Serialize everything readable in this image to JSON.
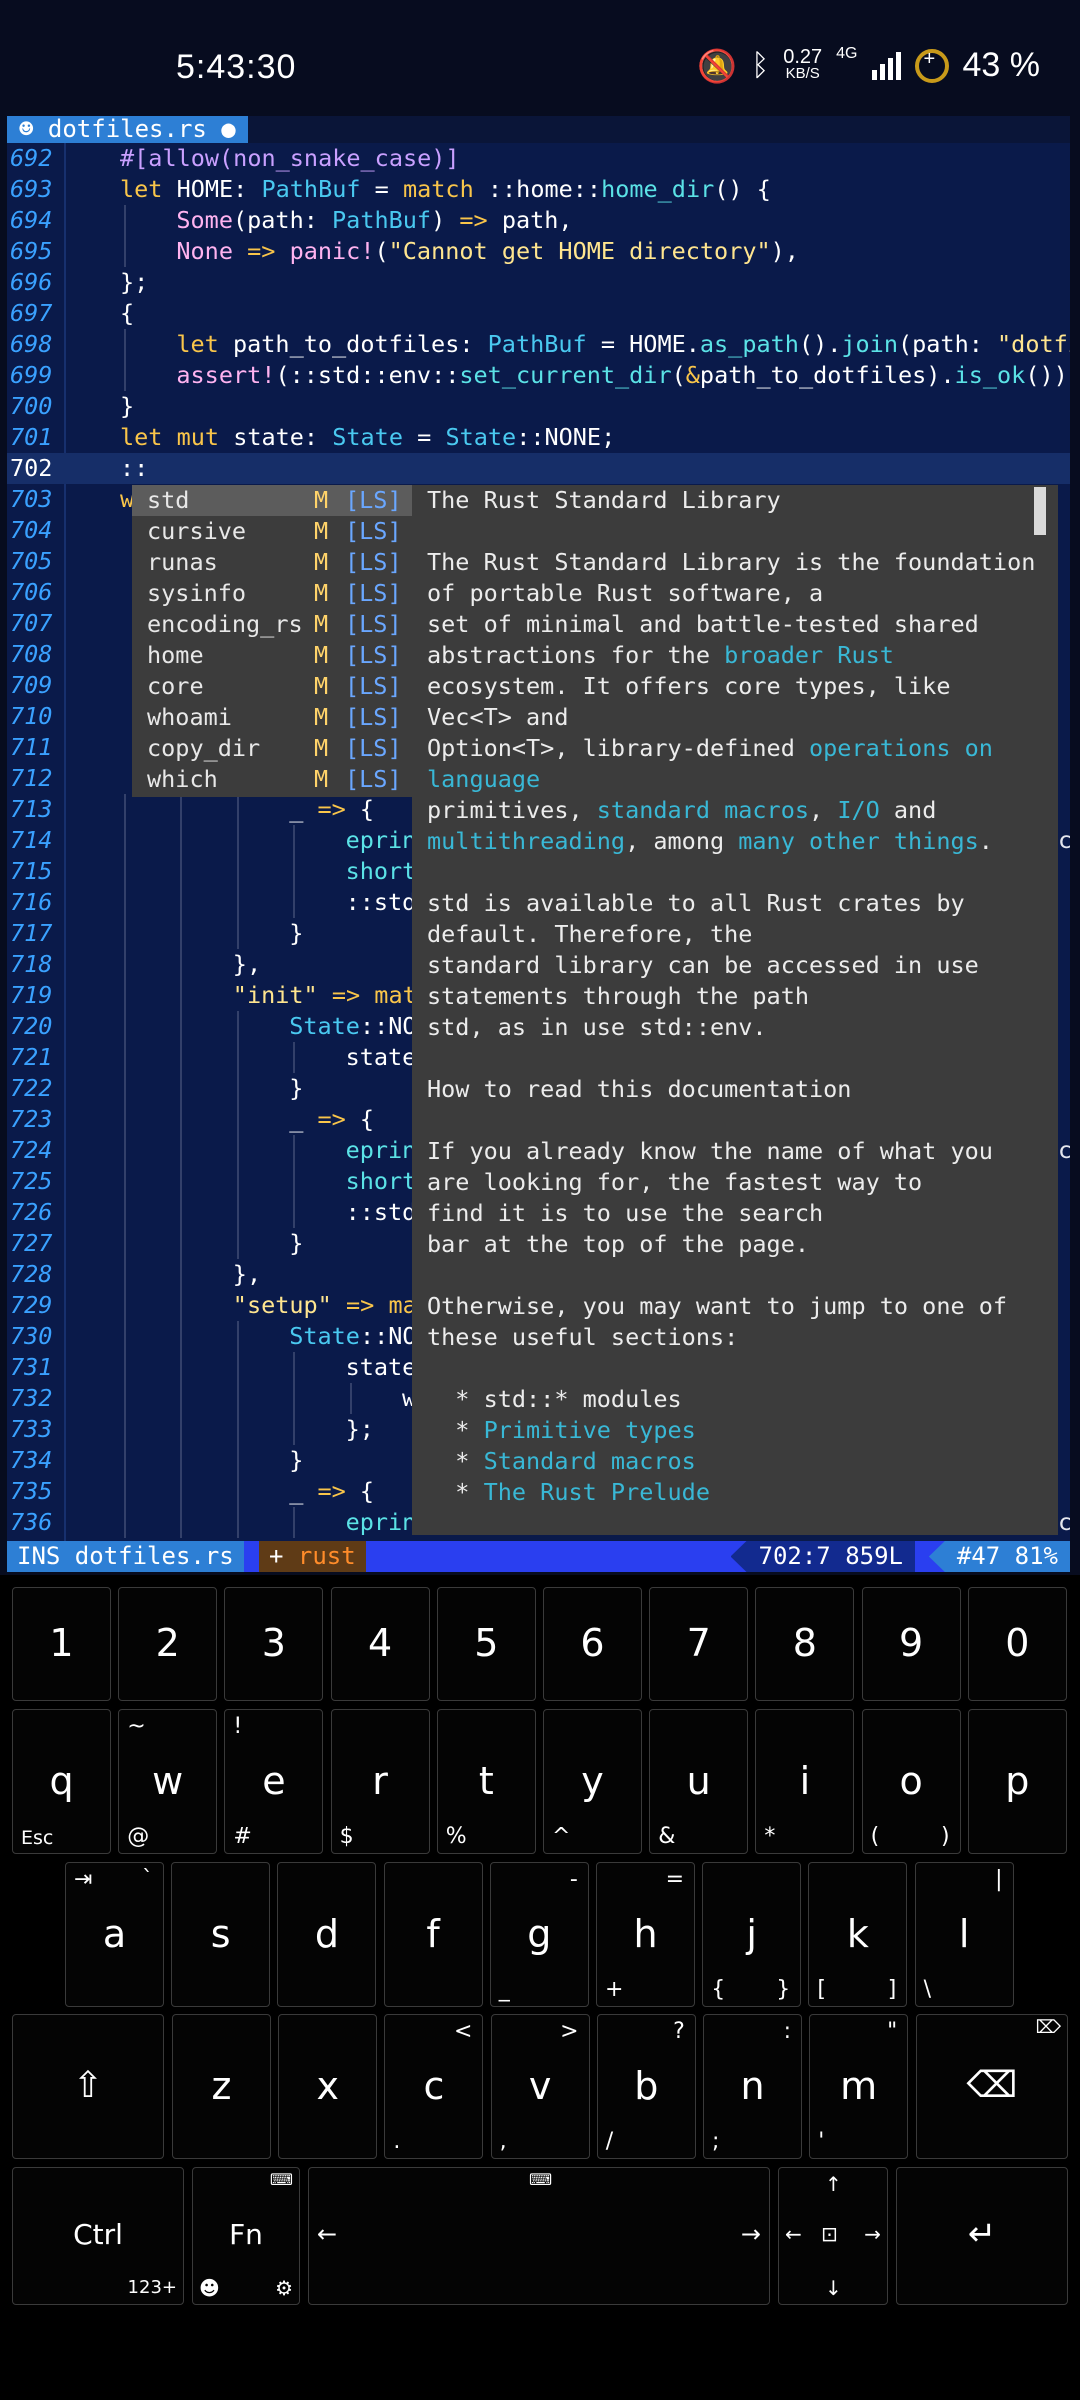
{
  "status": {
    "time": "5:43:30",
    "net_speed_value": "0.27",
    "net_speed_unit": "KB/S",
    "net_type": "4G",
    "battery": "43 %"
  },
  "tab": {
    "label": "☻ dotfiles.rs ●"
  },
  "lines": [
    {
      "num": "692",
      "indent": 0,
      "segs": [
        [
          "pp",
          "#[allow(non_snake_case)]"
        ]
      ]
    },
    {
      "num": "693",
      "indent": 0,
      "segs": [
        [
          "kw",
          "let "
        ],
        [
          "lt",
          "HOME: "
        ],
        [
          "ty",
          "PathBuf"
        ],
        [
          "lt",
          " = "
        ],
        [
          "kw",
          "match "
        ],
        [
          "lt",
          "::home::"
        ],
        [
          "fn",
          "home_dir"
        ],
        [
          "lt",
          "() {"
        ]
      ]
    },
    {
      "num": "694",
      "indent": 1,
      "segs": [
        [
          "mac",
          "Some"
        ],
        [
          "lt",
          "(path: "
        ],
        [
          "ty",
          "PathBuf"
        ],
        [
          "lt",
          ") "
        ],
        [
          "op",
          "=>"
        ],
        [
          "lt",
          " path,"
        ]
      ]
    },
    {
      "num": "695",
      "indent": 1,
      "segs": [
        [
          "mac",
          "None"
        ],
        [
          "lt",
          " "
        ],
        [
          "op",
          "=>"
        ],
        [
          "lt",
          " "
        ],
        [
          "mac",
          "panic!"
        ],
        [
          "lt",
          "("
        ],
        [
          "st",
          "\"Cannot get HOME directory\""
        ],
        [
          "lt",
          "),"
        ]
      ]
    },
    {
      "num": "696",
      "indent": 0,
      "segs": [
        [
          "lt",
          "};"
        ]
      ]
    },
    {
      "num": "697",
      "indent": 0,
      "segs": [
        [
          "lt",
          "{"
        ]
      ]
    },
    {
      "num": "698",
      "indent": 1,
      "segs": [
        [
          "kw",
          "let "
        ],
        [
          "lt",
          "path_to_dotfiles: "
        ],
        [
          "ty",
          "PathBuf"
        ],
        [
          "lt",
          " = HOME."
        ],
        [
          "fn",
          "as_path"
        ],
        [
          "lt",
          "()."
        ],
        [
          "fn",
          "join"
        ],
        [
          "lt",
          "(path: "
        ],
        [
          "st",
          "\"dotfi"
        ]
      ]
    },
    {
      "num": "699",
      "indent": 1,
      "segs": [
        [
          "mac",
          "assert!"
        ],
        [
          "lt",
          "(::std::env::"
        ],
        [
          "fn",
          "set_current_dir"
        ],
        [
          "lt",
          "("
        ],
        [
          "op",
          "&"
        ],
        [
          "lt",
          "path_to_dotfiles)."
        ],
        [
          "fn",
          "is_ok"
        ],
        [
          "lt",
          "());"
        ]
      ]
    },
    {
      "num": "700",
      "indent": 0,
      "segs": [
        [
          "lt",
          "}"
        ]
      ]
    },
    {
      "num": "701",
      "indent": 0,
      "segs": [
        [
          "kw",
          "let "
        ],
        [
          "kw",
          "mut "
        ],
        [
          "lt",
          "state: "
        ],
        [
          "ty",
          "State"
        ],
        [
          "lt",
          " = "
        ],
        [
          "ty",
          "State"
        ],
        [
          "lt",
          "::NONE;"
        ]
      ]
    },
    {
      "num": "702",
      "indent": 0,
      "cur": true,
      "segs": [
        [
          "lt",
          "::"
        ]
      ]
    },
    {
      "num": "703",
      "indent": 0,
      "segs": [
        [
          "kw",
          "w"
        ]
      ]
    },
    {
      "num": "704",
      "indent": 0,
      "segs": []
    },
    {
      "num": "705",
      "indent": 0,
      "segs": []
    },
    {
      "num": "706",
      "indent": 0,
      "segs": []
    },
    {
      "num": "707",
      "indent": 0,
      "segs": []
    },
    {
      "num": "708",
      "indent": 0,
      "segs": []
    },
    {
      "num": "709",
      "indent": 0,
      "segs": []
    },
    {
      "num": "710",
      "indent": 0,
      "segs": []
    },
    {
      "num": "711",
      "indent": 0,
      "segs": []
    },
    {
      "num": "712",
      "indent": 0,
      "segs": []
    },
    {
      "num": "713",
      "indent": 3,
      "segs": [
        [
          "lt",
          "_ "
        ],
        [
          "op",
          "=>"
        ],
        [
          "lt",
          " {"
        ]
      ]
    },
    {
      "num": "714",
      "indent": 4,
      "segs": [
        [
          "fn",
          "eprin"
        ]
      ]
    },
    {
      "num": "715",
      "indent": 4,
      "segs": [
        [
          "fn",
          "short"
        ]
      ]
    },
    {
      "num": "716",
      "indent": 4,
      "segs": [
        [
          "lt",
          "::std"
        ]
      ]
    },
    {
      "num": "717",
      "indent": 3,
      "segs": [
        [
          "lt",
          "}"
        ]
      ]
    },
    {
      "num": "718",
      "indent": 2,
      "segs": [
        [
          "lt",
          "},"
        ]
      ]
    },
    {
      "num": "719",
      "indent": 2,
      "segs": [
        [
          "st",
          "\"init\""
        ],
        [
          "lt",
          " "
        ],
        [
          "op",
          "=>"
        ],
        [
          "lt",
          " "
        ],
        [
          "kw",
          "mat"
        ]
      ]
    },
    {
      "num": "720",
      "indent": 3,
      "segs": [
        [
          "ty",
          "State"
        ],
        [
          "lt",
          "::NO"
        ]
      ]
    },
    {
      "num": "721",
      "indent": 4,
      "segs": [
        [
          "lt",
          "state"
        ]
      ]
    },
    {
      "num": "722",
      "indent": 3,
      "segs": [
        [
          "lt",
          "}"
        ]
      ]
    },
    {
      "num": "723",
      "indent": 3,
      "segs": [
        [
          "lt",
          "_ "
        ],
        [
          "op",
          "=>"
        ],
        [
          "lt",
          " {"
        ]
      ]
    },
    {
      "num": "724",
      "indent": 4,
      "segs": [
        [
          "fn",
          "eprin"
        ]
      ]
    },
    {
      "num": "725",
      "indent": 4,
      "segs": [
        [
          "fn",
          "short"
        ]
      ]
    },
    {
      "num": "726",
      "indent": 4,
      "segs": [
        [
          "lt",
          "::std"
        ]
      ]
    },
    {
      "num": "727",
      "indent": 3,
      "segs": [
        [
          "lt",
          "}"
        ]
      ]
    },
    {
      "num": "728",
      "indent": 2,
      "segs": [
        [
          "lt",
          "},"
        ]
      ]
    },
    {
      "num": "729",
      "indent": 2,
      "segs": [
        [
          "st",
          "\"setup\""
        ],
        [
          "lt",
          " "
        ],
        [
          "op",
          "=>"
        ],
        [
          "lt",
          " "
        ],
        [
          "kw",
          "ma"
        ]
      ]
    },
    {
      "num": "730",
      "indent": 3,
      "segs": [
        [
          "ty",
          "State"
        ],
        [
          "lt",
          "::NO"
        ]
      ]
    },
    {
      "num": "731",
      "indent": 4,
      "segs": [
        [
          "lt",
          "state"
        ]
      ]
    },
    {
      "num": "732",
      "indent": 5,
      "segs": [
        [
          "lt",
          "w"
        ]
      ]
    },
    {
      "num": "733",
      "indent": 4,
      "segs": [
        [
          "lt",
          "};"
        ]
      ]
    },
    {
      "num": "734",
      "indent": 3,
      "segs": [
        [
          "lt",
          "}"
        ]
      ]
    },
    {
      "num": "735",
      "indent": 3,
      "segs": [
        [
          "lt",
          "_ "
        ],
        [
          "op",
          "=>"
        ],
        [
          "lt",
          " {"
        ]
      ]
    },
    {
      "num": "736",
      "indent": 4,
      "segs": [
        [
          "fn",
          "eprin"
        ]
      ]
    }
  ],
  "right_edge": {
    "714": "c",
    "724": "c",
    "736": "c"
  },
  "completion": {
    "items": [
      {
        "name": "std",
        "kind": "M",
        "source": "[LS]"
      },
      {
        "name": "cursive",
        "kind": "M",
        "source": "[LS]"
      },
      {
        "name": "runas",
        "kind": "M",
        "source": "[LS]"
      },
      {
        "name": "sysinfo",
        "kind": "M",
        "source": "[LS]"
      },
      {
        "name": "encoding_rs",
        "kind": "M",
        "source": "[LS]"
      },
      {
        "name": "home",
        "kind": "M",
        "source": "[LS]"
      },
      {
        "name": "core",
        "kind": "M",
        "source": "[LS]"
      },
      {
        "name": "whoami",
        "kind": "M",
        "source": "[LS]"
      },
      {
        "name": "copy_dir",
        "kind": "M",
        "source": "[LS]"
      },
      {
        "name": "which",
        "kind": "M",
        "source": "[LS]"
      }
    ]
  },
  "doc": [
    [
      [
        "t",
        "The Rust Standard Library"
      ]
    ],
    [],
    [
      [
        "t",
        "The Rust Standard Library is the foundation"
      ]
    ],
    [
      [
        "t",
        "of portable Rust software, a"
      ]
    ],
    [
      [
        "t",
        "set of minimal and battle-tested shared"
      ]
    ],
    [
      [
        "t",
        "abstractions for the "
      ],
      [
        "l",
        "broader Rust"
      ]
    ],
    [
      [
        "t",
        "ecosystem. It offers core types, like"
      ]
    ],
    [
      [
        "t",
        "Vec<T> and"
      ]
    ],
    [
      [
        "t",
        "Option<T>, library-defined "
      ],
      [
        "l",
        "operations on"
      ]
    ],
    [
      [
        "l",
        "language"
      ]
    ],
    [
      [
        "t",
        "primitives, "
      ],
      [
        "l",
        "standard macros"
      ],
      [
        "t",
        ", "
      ],
      [
        "l",
        "I/O"
      ],
      [
        "t",
        " and"
      ]
    ],
    [
      [
        "l",
        "multithreading"
      ],
      [
        "t",
        ", among "
      ],
      [
        "l",
        "many other things"
      ],
      [
        "t",
        "."
      ]
    ],
    [],
    [
      [
        "t",
        "std is available to all Rust crates by"
      ]
    ],
    [
      [
        "t",
        "default. Therefore, the"
      ]
    ],
    [
      [
        "t",
        "standard library can be accessed in use"
      ]
    ],
    [
      [
        "t",
        "statements through the path"
      ]
    ],
    [
      [
        "t",
        "std, as in use std::env."
      ]
    ],
    [],
    [
      [
        "t",
        "How to read this documentation"
      ]
    ],
    [],
    [
      [
        "t",
        "If you already know the name of what you"
      ]
    ],
    [
      [
        "t",
        "are looking for, the fastest way to"
      ]
    ],
    [
      [
        "t",
        "find it is to use the search"
      ]
    ],
    [
      [
        "t",
        "bar at the top of the page."
      ]
    ],
    [],
    [
      [
        "t",
        "Otherwise, you may want to jump to one of"
      ]
    ],
    [
      [
        "t",
        "these useful sections:"
      ]
    ],
    [],
    [
      [
        "t",
        "  * std::* modules"
      ]
    ],
    [
      [
        "t",
        "  * "
      ],
      [
        "l",
        "Primitive types"
      ]
    ],
    [
      [
        "t",
        "  * "
      ],
      [
        "l",
        "Standard macros"
      ]
    ],
    [
      [
        "t",
        "  * "
      ],
      [
        "l",
        "The Rust Prelude"
      ]
    ]
  ],
  "statusline": {
    "mode": "INS dotfiles.rs",
    "modified": "+",
    "lang": "rust",
    "position": "702:7 859L",
    "percent": "#47 81%"
  },
  "keyboard": {
    "row1": [
      "1",
      "2",
      "3",
      "4",
      "5",
      "6",
      "7",
      "8",
      "9",
      "0"
    ],
    "row2": [
      {
        "m": "q",
        "bl": "Esc"
      },
      {
        "m": "w",
        "tl": "~",
        "bl": "@"
      },
      {
        "m": "e",
        "tl": "!",
        "bl": "#"
      },
      {
        "m": "r",
        "bl": "$"
      },
      {
        "m": "t",
        "bl": "%"
      },
      {
        "m": "y",
        "bl": "^"
      },
      {
        "m": "u",
        "bl": "&"
      },
      {
        "m": "i",
        "bl": "*"
      },
      {
        "m": "o",
        "bl": "(",
        "br": ")"
      },
      {
        "m": "p"
      }
    ],
    "row3": [
      {
        "m": "a",
        "tl": "⇥",
        "tr": "`"
      },
      {
        "m": "s"
      },
      {
        "m": "d"
      },
      {
        "m": "f"
      },
      {
        "m": "g",
        "tr": "-",
        "bl": "_"
      },
      {
        "m": "h",
        "tr": "=",
        "bl": "+"
      },
      {
        "m": "j",
        "bl": "{",
        "br": "}"
      },
      {
        "m": "k",
        "bl": "[",
        "br": "]"
      },
      {
        "m": "l",
        "tr": "|",
        "bl": "\\"
      }
    ],
    "row4": [
      {
        "m": "z"
      },
      {
        "m": "x"
      },
      {
        "m": "c",
        "tr": "<",
        "bl": "."
      },
      {
        "m": "v",
        "tr": ">",
        "bl": ","
      },
      {
        "m": "b",
        "tr": "?",
        "bl": "/"
      },
      {
        "m": "n",
        "tr": ":",
        "bl": ";"
      },
      {
        "m": "m",
        "tr": "\"",
        "bl": "'"
      }
    ],
    "ctrl": "Ctrl",
    "fn": "Fn",
    "fn_sub": "123+"
  }
}
